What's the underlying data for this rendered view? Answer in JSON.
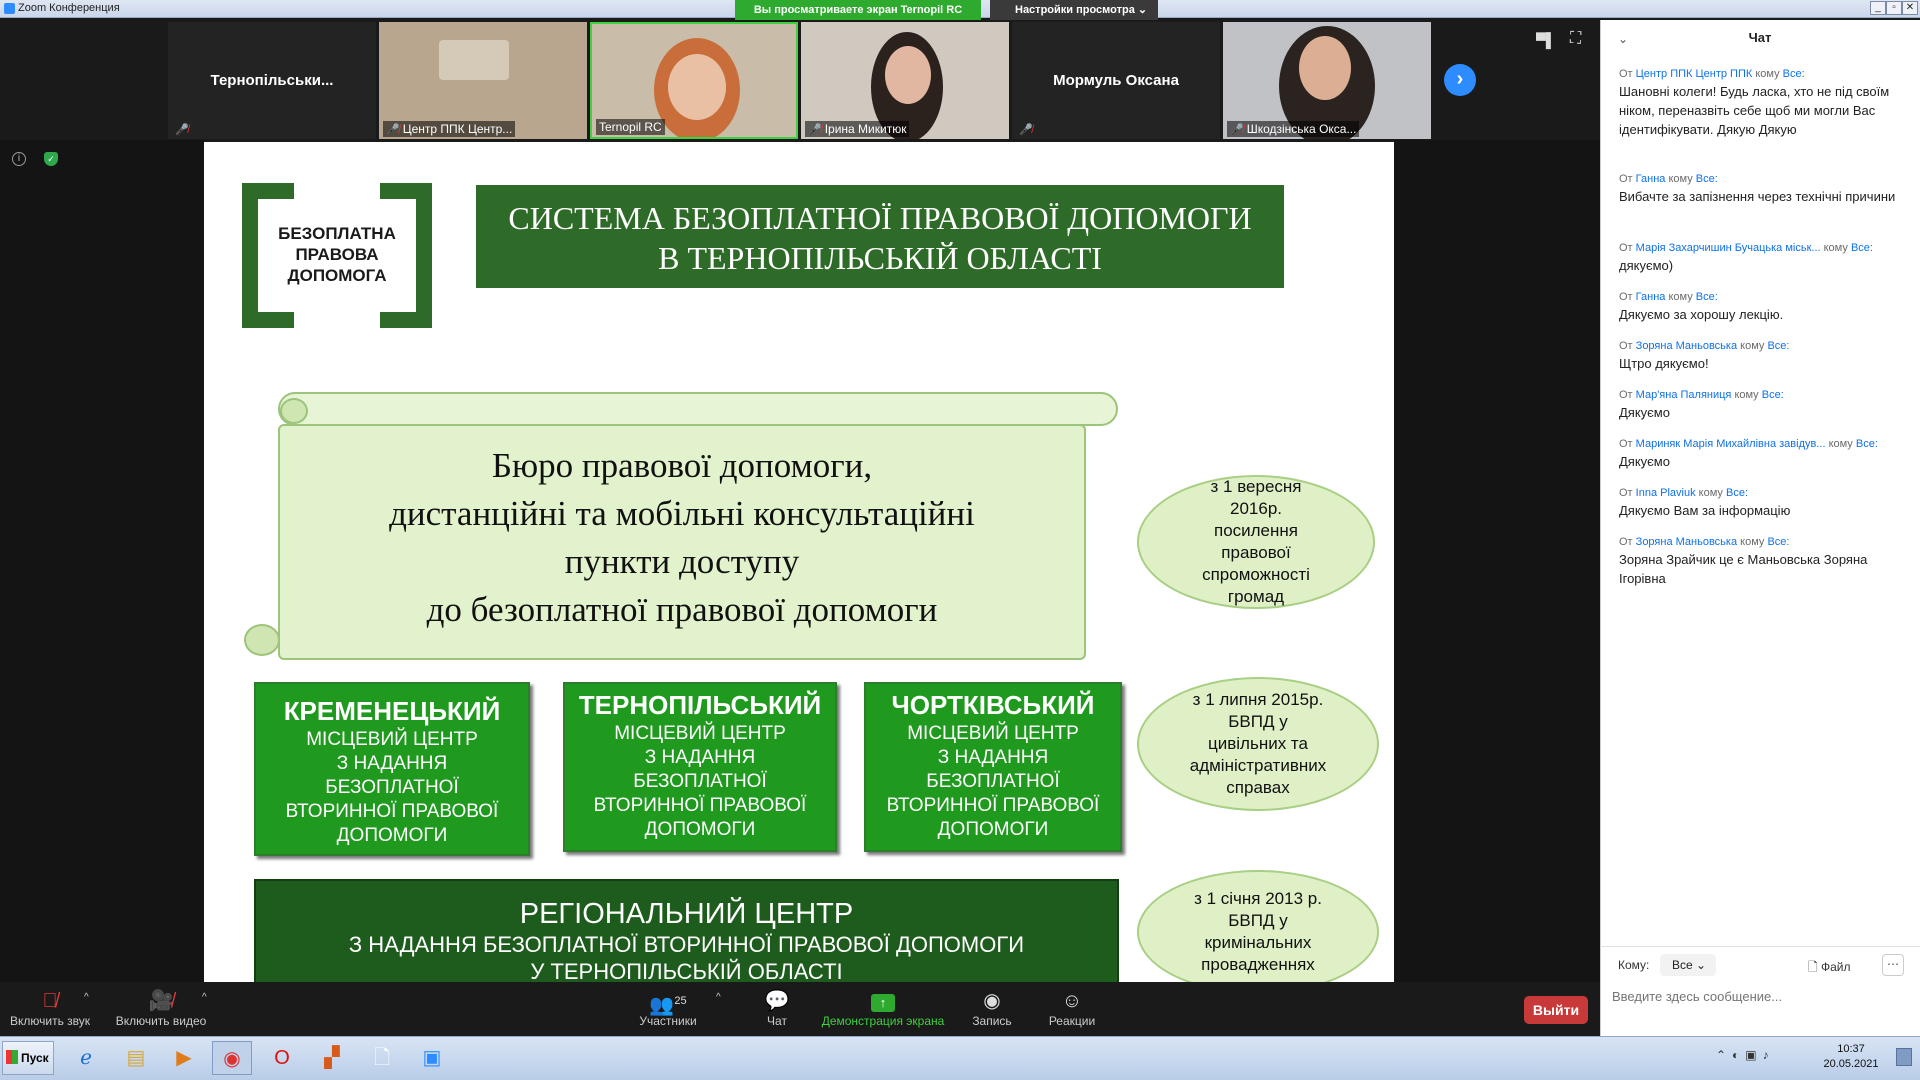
{
  "window": {
    "title": "Zoom Конференция"
  },
  "share_banner": "Вы просматриваете экран Ternopil RC",
  "view_options": "Настройки просмотра",
  "gallery": [
    {
      "name": "Тернопільськи...",
      "video": false
    },
    {
      "name": "Центр ППК Центр...",
      "video": true
    },
    {
      "name": "Ternopil RC",
      "video": true
    },
    {
      "name": "Ірина Микитюк",
      "video": true
    },
    {
      "name": "Мормуль Оксана",
      "video": false
    },
    {
      "name": "Шкодзінська Окса...",
      "video": true
    }
  ],
  "slide": {
    "logo": [
      "БЕЗОПЛАТНА",
      "ПРАВОВА",
      "ДОПОМОГА"
    ],
    "title": [
      "СИСТЕМА БЕЗОПЛАТНОЇ  ПРАВОВОЇ ДОПОМОГИ",
      "В ТЕРНОПІЛЬСЬКІЙ ОБЛАСТІ"
    ],
    "scroll": [
      "Бюро правової допомоги,",
      "дистанційні та мобільні консультаційні",
      "пункти доступу",
      "до безоплатної правової допомоги"
    ],
    "oval1": [
      "з 1 вересня",
      "2016р.",
      "посилення",
      "правової",
      "спроможності",
      "громад"
    ],
    "oval2": [
      "з 1 липня 2015р.",
      "БВПД у",
      "цивільних та",
      "адміністративних",
      "справах"
    ],
    "oval3": [
      "з 1 січня 2013 р.",
      "БВПД у",
      "кримінальних",
      "провадженнях"
    ],
    "centers": [
      {
        "name": "КРЕМЕНЕЦЬКИЙ",
        "lines": [
          "МІСЦЕВИЙ ЦЕНТР",
          "З НАДАННЯ",
          "БЕЗОПЛАТНОЇ",
          "ВТОРИННОЇ ПРАВОВОЇ",
          "ДОПОМОГИ"
        ]
      },
      {
        "name": "ТЕРНОПІЛЬСЬКИЙ",
        "lines": [
          "МІСЦЕВИЙ ЦЕНТР",
          "З НАДАННЯ",
          "БЕЗОПЛАТНОЇ",
          "ВТОРИННОЇ ПРАВОВОЇ",
          "ДОПОМОГИ"
        ]
      },
      {
        "name": "ЧОРТКІВСЬКИЙ",
        "lines": [
          "МІСЦЕВИЙ ЦЕНТР",
          "З НАДАННЯ",
          "БЕЗОПЛАТНОЇ",
          "ВТОРИННОЇ ПРАВОВОЇ",
          "ДОПОМОГИ"
        ]
      }
    ],
    "region": [
      "РЕГІОНАЛЬНИЙ ЦЕНТР",
      "З НАДАННЯ БЕЗОПЛАТНОЇ ВТОРИННОЇ ПРАВОВОЇ ДОПОМОГИ",
      "У ТЕРНОПІЛЬСЬКІЙ ОБЛАСТІ"
    ]
  },
  "chat": {
    "title": "Чат",
    "messages": [
      {
        "from": "Центр ППК Центр ППК",
        "to": "Все:",
        "text": "Шановні колеги! Будь ласка, хто не під своїм ніком, переназвіть себе щоб ми могли Вас ідентифікувати. Дякую Дякую"
      },
      {
        "from": "Ганна",
        "to": "Все:",
        "text": "Вибачте за запізнення через технічні причини"
      },
      {
        "from": "Марія Захарчишин Бучацька міськ...",
        "to": "Все:",
        "text": "дякуємо)"
      },
      {
        "from": "Ганна",
        "to": "Все:",
        "text": "Дякуємо за  хорошу лекцію."
      },
      {
        "from": "Зоряна Маньовська",
        "to": "Все:",
        "text": "Щтро дякуємо!"
      },
      {
        "from": "Мар'яна Паляниця",
        "to": "Все:",
        "text": "Дякуємо"
      },
      {
        "from": "Мариняк Марія Михайлівна завідув...",
        "to": "Все:",
        "text": "Дякуємо"
      },
      {
        "from": "Inna Plaviuk",
        "to": "Все:",
        "text": "Дякуємо Вам за інформацію"
      },
      {
        "from": "Зоряна Маньовська",
        "to": "Все:",
        "text": "Зоряна Зрайчик це є Маньовська Зоряна Ігорівна"
      }
    ],
    "from_label": "От",
    "to_label": "кому",
    "recipient_label": "Кому:",
    "recipient_value": "Все",
    "file_label": "Файл",
    "input_placeholder": "Введите здесь сообщение..."
  },
  "toolbar": {
    "mute": "Включить звук",
    "video": "Включить видео",
    "participants": "Участники",
    "participants_count": "25",
    "chat": "Чат",
    "share": "Демонстрация экрана",
    "record": "Запись",
    "reactions": "Реакции",
    "leave": "Выйти"
  },
  "taskbar": {
    "start": "Пуск",
    "time": "10:37",
    "date": "20.05.2021"
  },
  "colors": {
    "slide_green": "#2f6b28",
    "box_green": "#1f9a1f",
    "share_green": "#2eaa2e",
    "leave_red": "#c83a3a",
    "zoom_blue": "#2d8cff"
  }
}
